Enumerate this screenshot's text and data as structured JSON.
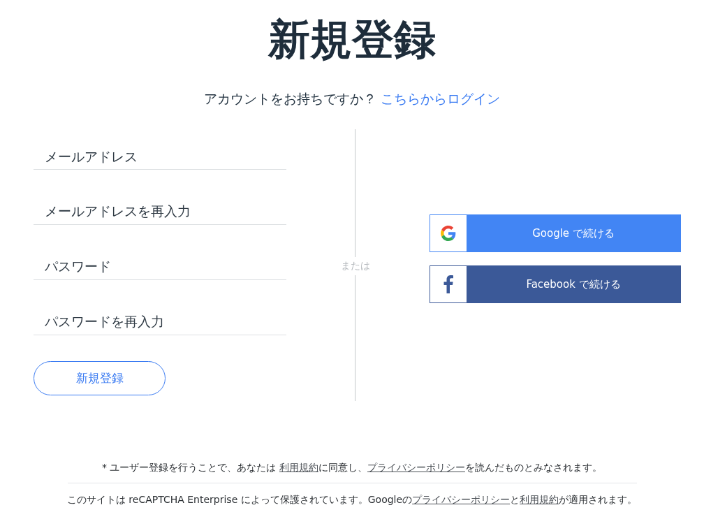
{
  "title": "新規登録",
  "login_prompt": {
    "text": "アカウントをお持ちですか？",
    "link": "こちらからログイン"
  },
  "fields": [
    {
      "placeholder": "メールアドレス"
    },
    {
      "placeholder": "メールアドレスを再入力"
    },
    {
      "placeholder": "パスワード"
    },
    {
      "placeholder": "パスワードを再入力"
    }
  ],
  "submit_button": "新規登録",
  "divider_label": "または",
  "social_buttons": [
    {
      "kind": "google",
      "label": "Google で続ける"
    },
    {
      "kind": "facebook",
      "label": "Facebook で続ける"
    }
  ],
  "footer": [
    [
      {
        "text": "* ユーザー登録を行うことで、あなたは "
      },
      {
        "text": "利用規約",
        "link": true
      },
      {
        "text": "に同意し、"
      },
      {
        "text": "プライバシーポリシー",
        "link": true
      },
      {
        "text": "を読んだものとみなされます。"
      }
    ],
    [
      {
        "text": "このサイトは reCAPTCHA Enterprise によって保護されています。Googleの"
      },
      {
        "text": "プライバシーポリシー",
        "link": true
      },
      {
        "text": "と"
      },
      {
        "text": "利用規約",
        "link": true
      },
      {
        "text": "が適用されます。"
      }
    ]
  ]
}
